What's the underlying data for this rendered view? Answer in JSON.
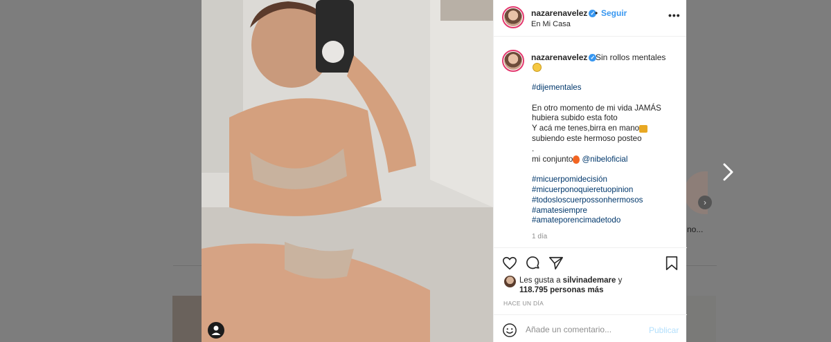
{
  "post": {
    "username": "nazarenavelez",
    "follow_label": "Seguir",
    "header_dot": "•",
    "location": "En Mi Casa",
    "more_label": "•••",
    "verified_glyph": "✓"
  },
  "caption": {
    "first_line": "Sin rollos mentales",
    "lines": [
      {
        "text": "#dijementales",
        "kind": "tag"
      },
      {
        "text": "",
        "kind": "gap"
      },
      {
        "text": "En otro momento de mi vida JAMÁS",
        "kind": "text"
      },
      {
        "text": "hubiera subido esta foto",
        "kind": "text"
      },
      {
        "text": "Y acá me tenes,birra en mano",
        "kind": "beer"
      },
      {
        "text": "subiendo este hermoso posteo",
        "kind": "text"
      },
      {
        "text": ".",
        "kind": "text"
      },
      {
        "text": "mi conjunto",
        "kind": "fire",
        "mention": "@nibeloficial"
      },
      {
        "text": "",
        "kind": "gap"
      },
      {
        "text": "#micuerpomidecisión",
        "kind": "tag"
      },
      {
        "text": "#micuerponoquieretuopinion",
        "kind": "tag"
      },
      {
        "text": "#todosloscuerpossonhermosos",
        "kind": "tag"
      },
      {
        "text": "#amatesiempre",
        "kind": "tag"
      },
      {
        "text": "#amateporencimadetodo",
        "kind": "tag"
      }
    ],
    "time": "1 día"
  },
  "likes": {
    "prefix": "Les gusta a",
    "user": "silvinademare",
    "conj": "y",
    "count_text": "118.795 personas más"
  },
  "posted_ago": "HACE UN DÍA",
  "comment": {
    "placeholder": "Añade un comentario...",
    "publish_label": "Publicar"
  },
  "background": {
    "story_label": "no..."
  },
  "colors": {
    "link_blue": "#3897f0",
    "hashtag": "#00376b",
    "story_ring": "#e3376d"
  }
}
